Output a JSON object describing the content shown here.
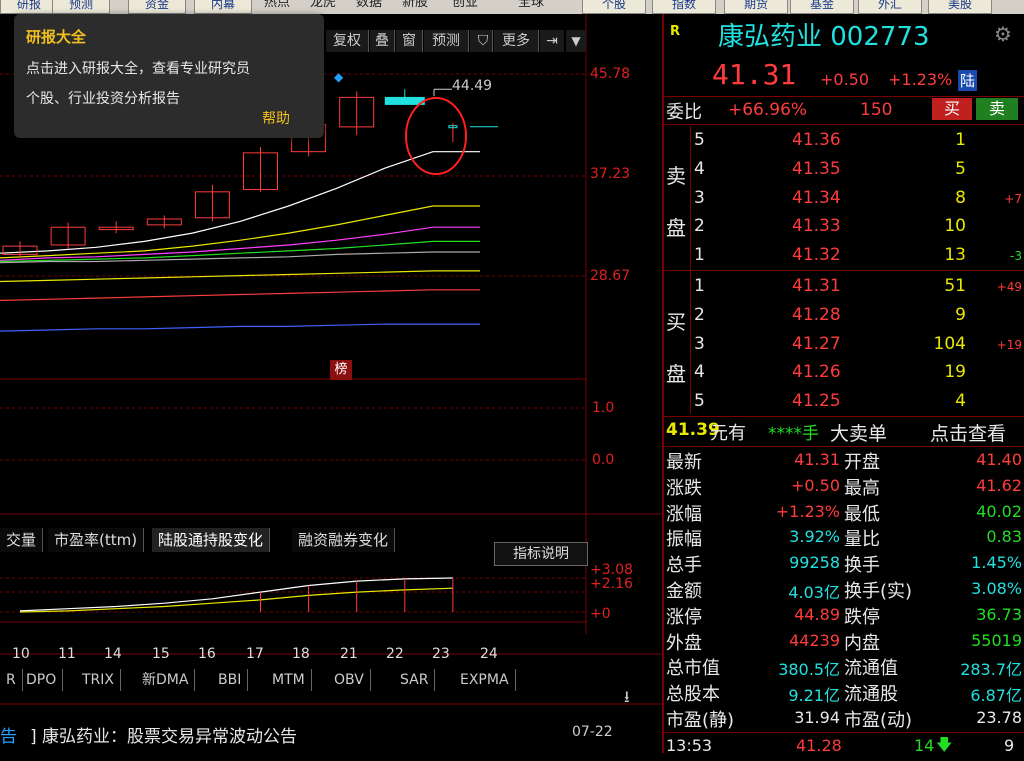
{
  "toolbar": {
    "items": [
      "研报",
      "预测",
      "资金",
      "内幕",
      "热点",
      "龙虎",
      "数据",
      "新股",
      "创业",
      "全球"
    ],
    "right_items": [
      "个股",
      "指数",
      "期货",
      "基金",
      "外汇",
      "美股"
    ]
  },
  "tooltip": {
    "title": "研报大全",
    "line1": "点击进入研报大全，查看专业研究员",
    "line2": "个股、行业投资分析报告",
    "help": "帮助"
  },
  "chart_tools": [
    "复权",
    "叠",
    "窗",
    "预测",
    "",
    "更多"
  ],
  "price_axis": [
    "45.78",
    "37.23",
    "28.67"
  ],
  "peak_label": "44.49",
  "bang_label": "榜",
  "vol_axis": [
    "1.0",
    "0.0"
  ],
  "tabs": [
    "交量",
    "市盈率(ttm)",
    "陆股通持股变化",
    "融资融券变化"
  ],
  "indicator_button": "指标说明",
  "ind_axis": [
    "+3.08",
    "+2.16",
    "+0"
  ],
  "x_ticks": [
    "10",
    "11",
    "14",
    "15",
    "16",
    "17",
    "18",
    "21",
    "22",
    "23",
    "24"
  ],
  "indicators": [
    "R",
    "DPO",
    "TRIX",
    "新DMA",
    "BBI",
    "MTM",
    "OBV",
    "SAR",
    "EXPMA"
  ],
  "news": {
    "prefix": "告",
    "title": "]  康弘药业：股票交易异常波动公告",
    "date": "07-22"
  },
  "stock": {
    "badge": "R",
    "name": "康弘药业 002773",
    "price": "41.31",
    "change": "+0.50",
    "change_pct": "+1.23%",
    "tag": "陆"
  },
  "webi": {
    "label": "委比",
    "pct": "+66.96%",
    "diff": "150",
    "buy": "买",
    "sell": "卖"
  },
  "sell_side_label": [
    "卖",
    "盘"
  ],
  "buy_side_label": [
    "买",
    "盘"
  ],
  "sell_orders": [
    {
      "lvl": "5",
      "price": "41.36",
      "vol": "1",
      "chg": ""
    },
    {
      "lvl": "4",
      "price": "41.35",
      "vol": "5",
      "chg": ""
    },
    {
      "lvl": "3",
      "price": "41.34",
      "vol": "8",
      "chg": "+7"
    },
    {
      "lvl": "2",
      "price": "41.33",
      "vol": "10",
      "chg": ""
    },
    {
      "lvl": "1",
      "price": "41.32",
      "vol": "13",
      "chg": "-3"
    }
  ],
  "buy_orders": [
    {
      "lvl": "1",
      "price": "41.31",
      "vol": "51",
      "chg": "+49"
    },
    {
      "lvl": "2",
      "price": "41.28",
      "vol": "9",
      "chg": ""
    },
    {
      "lvl": "3",
      "price": "41.27",
      "vol": "104",
      "chg": "+19"
    },
    {
      "lvl": "4",
      "price": "41.26",
      "vol": "19",
      "chg": ""
    },
    {
      "lvl": "5",
      "price": "41.25",
      "vol": "4",
      "chg": ""
    }
  ],
  "big_order": {
    "price": "41.39",
    "unit": "元有",
    "hands": "****手",
    "label": "大卖单",
    "link": "点击查看"
  },
  "stats": [
    {
      "l1": "最新",
      "v1": "41.31",
      "c1": "red",
      "l2": "开盘",
      "v2": "41.40",
      "c2": "red"
    },
    {
      "l1": "涨跌",
      "v1": "+0.50",
      "c1": "red",
      "l2": "最高",
      "v2": "41.62",
      "c2": "red"
    },
    {
      "l1": "涨幅",
      "v1": "+1.23%",
      "c1": "red",
      "l2": "最低",
      "v2": "40.02",
      "c2": "green"
    },
    {
      "l1": "振幅",
      "v1": "3.92%",
      "c1": "cyan",
      "l2": "量比",
      "v2": "0.83",
      "c2": "green"
    },
    {
      "l1": "总手",
      "v1": "99258",
      "c1": "cyan",
      "l2": "换手",
      "v2": "1.45%",
      "c2": "cyan"
    },
    {
      "l1": "金额",
      "v1": "4.03亿",
      "c1": "cyan",
      "l2": "换手(实)",
      "v2": "3.08%",
      "c2": "cyan"
    },
    {
      "l1": "涨停",
      "v1": "44.89",
      "c1": "red",
      "l2": "跌停",
      "v2": "36.73",
      "c2": "green"
    },
    {
      "l1": "外盘",
      "v1": "44239",
      "c1": "red",
      "l2": "内盘",
      "v2": "55019",
      "c2": "green"
    },
    {
      "l1": "总市值",
      "v1": "380.5亿",
      "c1": "cyan",
      "l2": "流通值",
      "v2": "283.7亿",
      "c2": "cyan"
    },
    {
      "l1": "总股本",
      "v1": "9.21亿",
      "c1": "cyan",
      "l2": "流通股",
      "v2": "6.87亿",
      "c2": "cyan"
    },
    {
      "l1": "市盈(静)",
      "v1": "31.94",
      "c1": "white",
      "l2": "市盈(动)",
      "v2": "23.78",
      "c2": "white"
    }
  ],
  "tick": {
    "time": "13:53",
    "price": "41.28",
    "vol": "14",
    "count": "9"
  },
  "colors": {
    "up": "#ff3c3c",
    "down": "#22dd22",
    "grid": "#7a0000",
    "cyan": "#22e0e0"
  },
  "chart_data": {
    "type": "candlestick",
    "x": [
      "10",
      "11",
      "14",
      "15",
      "16",
      "17",
      "18",
      "21",
      "22",
      "23",
      "24"
    ],
    "yticks": [
      45.78,
      37.23,
      28.67
    ],
    "candles": [
      {
        "o": 30.5,
        "h": 31.6,
        "l": 30.2,
        "c": 31.2
      },
      {
        "o": 31.3,
        "h": 33.2,
        "l": 31.0,
        "c": 32.8
      },
      {
        "o": 32.6,
        "h": 33.3,
        "l": 32.3,
        "c": 32.8
      },
      {
        "o": 33.0,
        "h": 33.8,
        "l": 32.7,
        "c": 33.5
      },
      {
        "o": 33.6,
        "h": 36.4,
        "l": 33.3,
        "c": 35.8
      },
      {
        "o": 36.0,
        "h": 39.6,
        "l": 35.8,
        "c": 39.1
      },
      {
        "o": 39.2,
        "h": 41.8,
        "l": 38.8,
        "c": 41.5
      },
      {
        "o": 41.3,
        "h": 44.3,
        "l": 40.6,
        "c": 43.8
      },
      {
        "o": 43.5,
        "h": 44.49,
        "l": 43.2,
        "c": 43.5
      },
      {
        "o": 41.4,
        "h": 41.62,
        "l": 40.02,
        "c": 41.31
      }
    ],
    "series": [
      {
        "values": [
          30.6,
          30.8,
          31.1,
          31.6,
          32.3,
          33.3,
          34.6,
          36.1,
          37.8,
          39.2
        ]
      },
      {
        "values": [
          30.2,
          30.4,
          30.6,
          30.8,
          31.2,
          31.7,
          32.3,
          33.0,
          33.8,
          34.6
        ]
      },
      {
        "values": [
          30.0,
          30.2,
          30.3,
          30.5,
          30.7,
          31.0,
          31.3,
          31.7,
          32.2,
          32.8
        ]
      },
      {
        "values": [
          29.9,
          30.0,
          30.1,
          30.2,
          30.4,
          30.6,
          30.8,
          31.0,
          31.3,
          31.6
        ]
      },
      {
        "values": [
          29.8,
          29.9,
          29.9,
          30.0,
          30.1,
          30.2,
          30.3,
          30.5,
          30.6,
          30.7
        ]
      },
      {
        "values": [
          28.2,
          28.3,
          28.4,
          28.5,
          28.6,
          28.7,
          28.8,
          28.9,
          29.0,
          29.1
        ]
      },
      {
        "values": [
          26.6,
          26.7,
          26.8,
          26.9,
          27.0,
          27.1,
          27.2,
          27.3,
          27.4,
          27.5
        ]
      },
      {
        "values": [
          24.0,
          24.1,
          24.2,
          24.2,
          24.3,
          24.4,
          24.4,
          24.5,
          24.6,
          24.6
        ]
      }
    ],
    "lower": {
      "axis": [
        3.08,
        2.16,
        0
      ],
      "white": [
        0.1,
        0.3,
        0.5,
        0.8,
        1.2,
        1.8,
        2.4,
        2.8,
        3.0,
        3.08
      ],
      "yellow": [
        0.0,
        0.1,
        0.3,
        0.5,
        0.8,
        1.1,
        1.5,
        1.8,
        2.0,
        2.16
      ]
    }
  }
}
